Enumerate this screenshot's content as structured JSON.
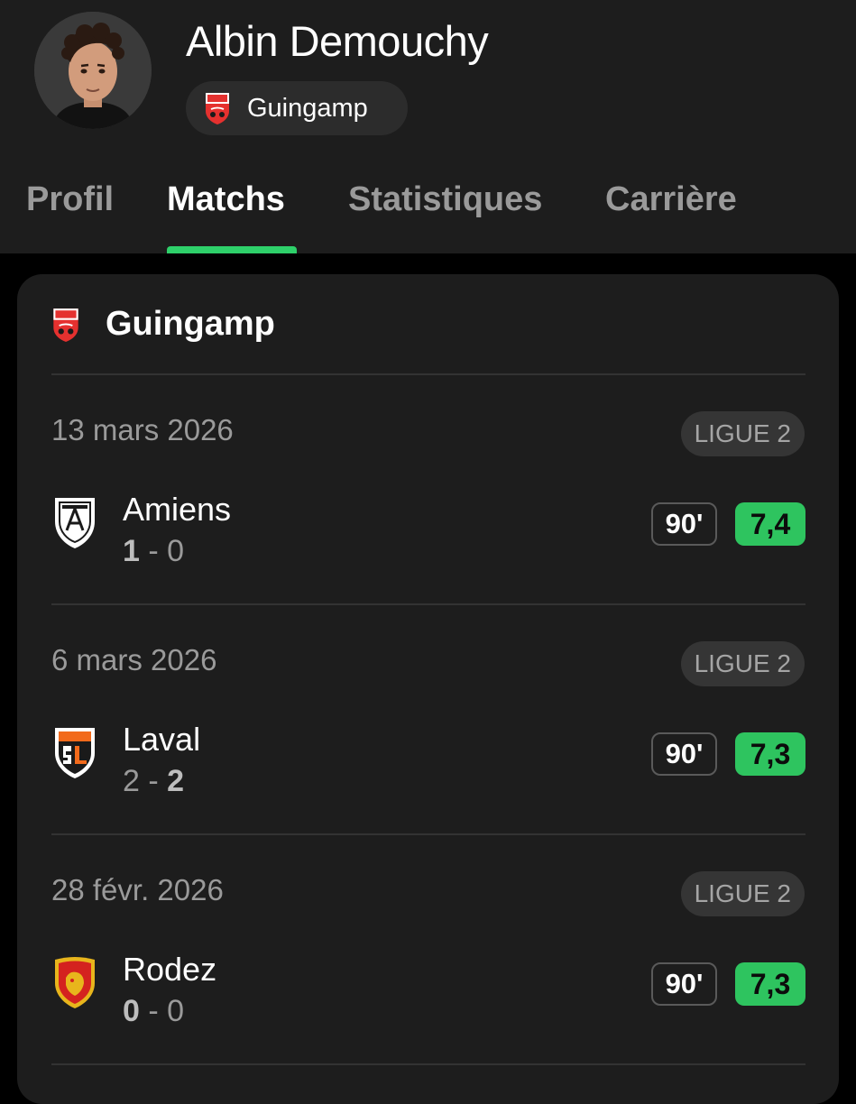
{
  "player": {
    "name": "Albin Demouchy",
    "team": "Guingamp"
  },
  "tabs": [
    {
      "label": "Profil",
      "active": false
    },
    {
      "label": "Matchs",
      "active": true
    },
    {
      "label": "Statistiques",
      "active": false
    },
    {
      "label": "Carrière",
      "active": false
    }
  ],
  "card": {
    "team": "Guingamp",
    "matches": [
      {
        "date": "13 mars 2026",
        "league": "LIGUE 2",
        "opponent": "Amiens",
        "score_home": "1",
        "score_sep": "-",
        "score_away": "0",
        "winner_side": "home",
        "minutes": "90'",
        "rating": "7,4",
        "crest_icon": "amiens-crest-icon"
      },
      {
        "date": "6 mars 2026",
        "league": "LIGUE 2",
        "opponent": "Laval",
        "score_home": "2",
        "score_sep": "-",
        "score_away": "2",
        "winner_side": "away",
        "minutes": "90'",
        "rating": "7,3",
        "crest_icon": "laval-crest-icon"
      },
      {
        "date": "28 févr. 2026",
        "league": "LIGUE 2",
        "opponent": "Rodez",
        "score_home": "0",
        "score_sep": "-",
        "score_away": "0",
        "winner_side": "home",
        "minutes": "90'",
        "rating": "7,3",
        "crest_icon": "rodez-crest-icon"
      }
    ]
  },
  "colors": {
    "accent": "#2ed06a",
    "rating_bg": "#2ec45f",
    "guingamp_red": "#e5312f"
  }
}
